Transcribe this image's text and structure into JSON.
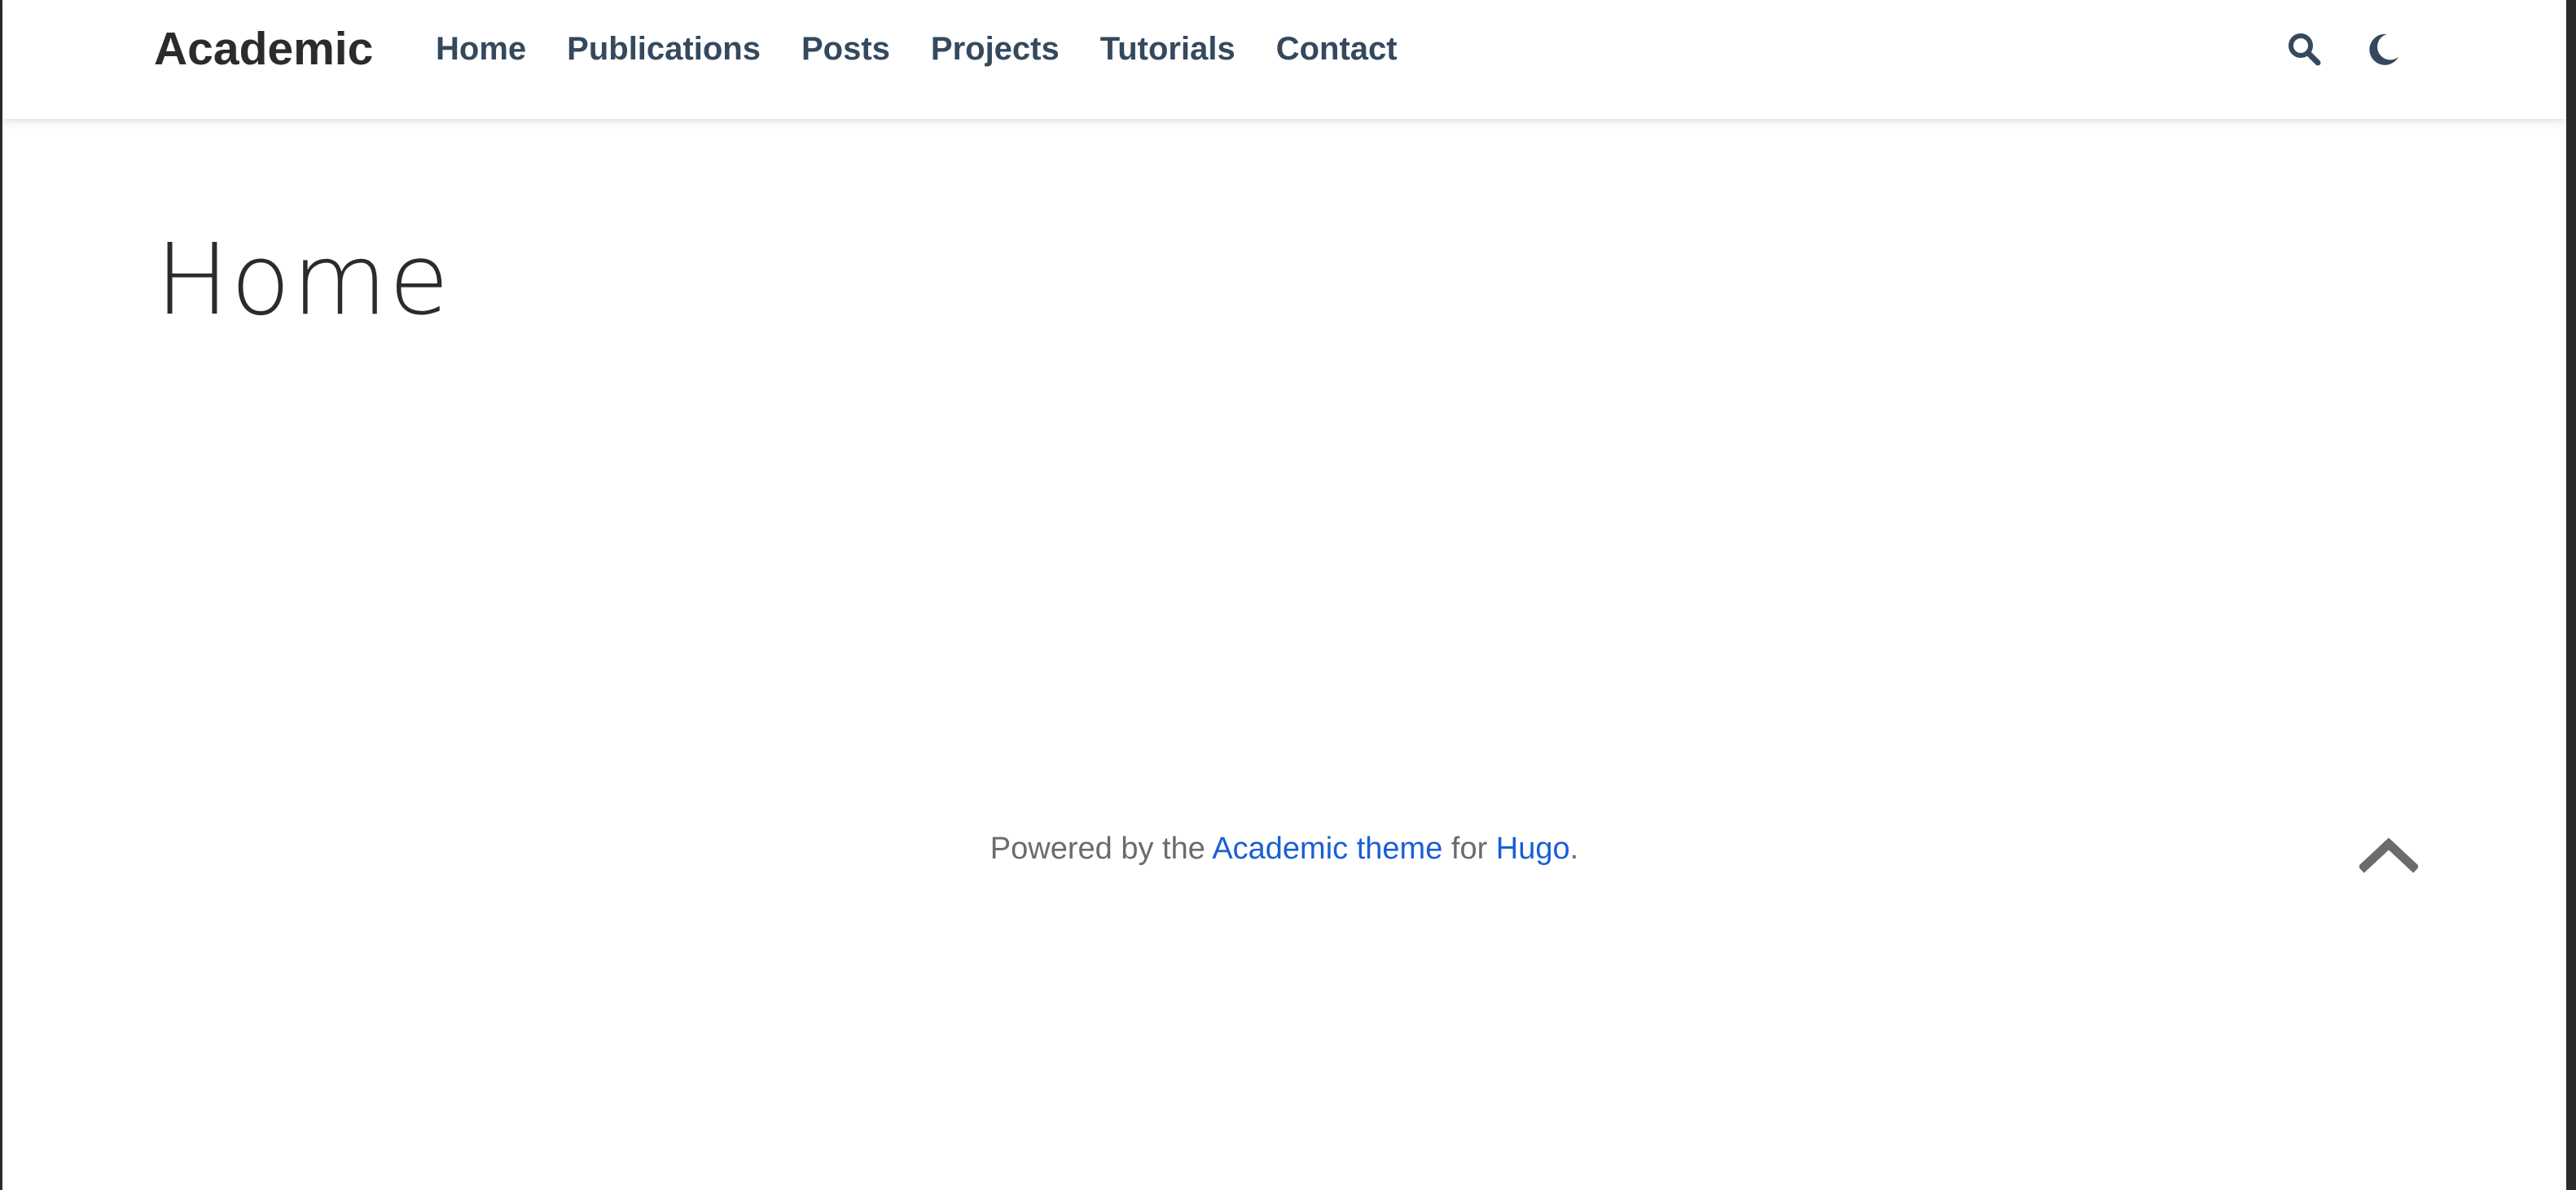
{
  "navbar": {
    "brand": "Academic",
    "links": [
      {
        "label": "Home"
      },
      {
        "label": "Publications"
      },
      {
        "label": "Posts"
      },
      {
        "label": "Projects"
      },
      {
        "label": "Tutorials"
      },
      {
        "label": "Contact"
      }
    ],
    "icons": {
      "search": "search-icon",
      "theme": "moon-icon"
    }
  },
  "main": {
    "title": "Home"
  },
  "footer": {
    "prefix": "Powered by the ",
    "theme_link": "Academic theme",
    "middle": " for ",
    "hugo_link": "Hugo",
    "suffix": ".",
    "back_to_top_icon": "chevron-up-icon"
  },
  "colors": {
    "nav_link": "#34495e",
    "footer_link": "#1a5fd6",
    "text": "#2b2b2b"
  }
}
